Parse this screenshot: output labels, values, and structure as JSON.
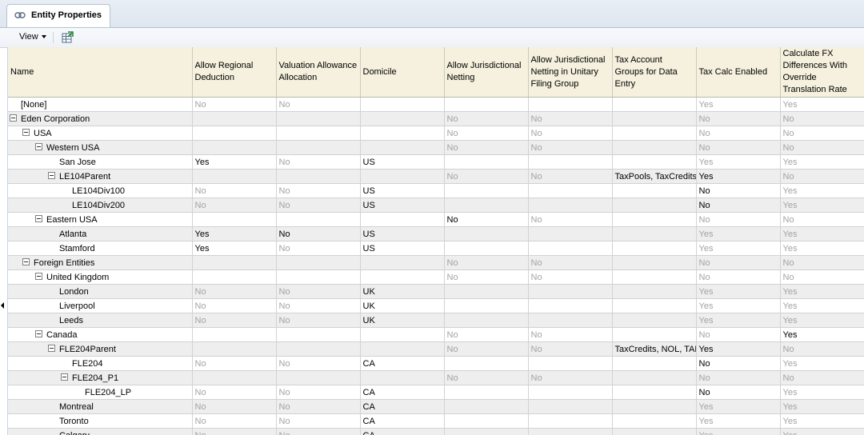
{
  "tab": {
    "title": "Entity Properties",
    "icon": "link-icon"
  },
  "toolbar": {
    "view_label": "View",
    "export_icon": "export-grid-icon"
  },
  "columns": [
    "Name",
    "Allow Regional Deduction",
    "Valuation Allowance Allocation",
    "Domicile",
    "Allow Jurisdictional Netting",
    "Allow Jurisdictional Netting in Unitary Filing Group",
    "Tax Account Groups for Data Entry",
    "Tax Calc Enabled",
    "Calculate FX Differences With Override Translation Rate"
  ],
  "rows": [
    {
      "name": "[None]",
      "level": 0,
      "toggle": false,
      "cells": [
        [
          "No",
          true
        ],
        [
          "No",
          true
        ],
        [
          "",
          false
        ],
        [
          "",
          false
        ],
        [
          "",
          false
        ],
        [
          "",
          false
        ],
        [
          "Yes",
          true
        ],
        [
          "Yes",
          true
        ]
      ]
    },
    {
      "name": "Eden Corporation",
      "level": 0,
      "toggle": true,
      "cells": [
        [
          "",
          false
        ],
        [
          "",
          false
        ],
        [
          "",
          false
        ],
        [
          "No",
          true
        ],
        [
          "No",
          true
        ],
        [
          "",
          false
        ],
        [
          "No",
          true
        ],
        [
          "No",
          true
        ]
      ]
    },
    {
      "name": "USA",
      "level": 1,
      "toggle": true,
      "cells": [
        [
          "",
          false
        ],
        [
          "",
          false
        ],
        [
          "",
          false
        ],
        [
          "No",
          true
        ],
        [
          "No",
          true
        ],
        [
          "",
          false
        ],
        [
          "No",
          true
        ],
        [
          "No",
          true
        ]
      ]
    },
    {
      "name": "Western USA",
      "level": 2,
      "toggle": true,
      "cells": [
        [
          "",
          false
        ],
        [
          "",
          false
        ],
        [
          "",
          false
        ],
        [
          "No",
          true
        ],
        [
          "No",
          true
        ],
        [
          "",
          false
        ],
        [
          "No",
          true
        ],
        [
          "No",
          true
        ]
      ]
    },
    {
      "name": "San Jose",
      "level": 3,
      "toggle": false,
      "cells": [
        [
          "Yes",
          false
        ],
        [
          "No",
          true
        ],
        [
          "US",
          false
        ],
        [
          "",
          false
        ],
        [
          "",
          false
        ],
        [
          "",
          false
        ],
        [
          "Yes",
          true
        ],
        [
          "Yes",
          true
        ]
      ]
    },
    {
      "name": "LE104Parent",
      "level": 3,
      "toggle": true,
      "cells": [
        [
          "",
          false
        ],
        [
          "",
          false
        ],
        [
          "",
          false
        ],
        [
          "No",
          true
        ],
        [
          "No",
          true
        ],
        [
          "TaxPools, TaxCredits",
          false
        ],
        [
          "Yes",
          false
        ],
        [
          "No",
          true
        ]
      ]
    },
    {
      "name": "LE104Div100",
      "level": 4,
      "toggle": false,
      "cells": [
        [
          "No",
          true
        ],
        [
          "No",
          true
        ],
        [
          "US",
          false
        ],
        [
          "",
          false
        ],
        [
          "",
          false
        ],
        [
          "",
          false
        ],
        [
          "No",
          false
        ],
        [
          "Yes",
          true
        ]
      ]
    },
    {
      "name": "LE104Div200",
      "level": 4,
      "toggle": false,
      "cells": [
        [
          "No",
          true
        ],
        [
          "No",
          true
        ],
        [
          "US",
          false
        ],
        [
          "",
          false
        ],
        [
          "",
          false
        ],
        [
          "",
          false
        ],
        [
          "No",
          false
        ],
        [
          "Yes",
          true
        ]
      ]
    },
    {
      "name": "Eastern USA",
      "level": 2,
      "toggle": true,
      "cells": [
        [
          "",
          false
        ],
        [
          "",
          false
        ],
        [
          "",
          false
        ],
        [
          "No",
          false
        ],
        [
          "No",
          true
        ],
        [
          "",
          false
        ],
        [
          "No",
          true
        ],
        [
          "No",
          true
        ]
      ]
    },
    {
      "name": "Atlanta",
      "level": 3,
      "toggle": false,
      "cells": [
        [
          "Yes",
          false
        ],
        [
          "No",
          false
        ],
        [
          "US",
          false
        ],
        [
          "",
          false
        ],
        [
          "",
          false
        ],
        [
          "",
          false
        ],
        [
          "Yes",
          true
        ],
        [
          "Yes",
          true
        ]
      ]
    },
    {
      "name": "Stamford",
      "level": 3,
      "toggle": false,
      "cells": [
        [
          "Yes",
          false
        ],
        [
          "No",
          true
        ],
        [
          "US",
          false
        ],
        [
          "",
          false
        ],
        [
          "",
          false
        ],
        [
          "",
          false
        ],
        [
          "Yes",
          true
        ],
        [
          "Yes",
          true
        ]
      ]
    },
    {
      "name": "Foreign Entities",
      "level": 1,
      "toggle": true,
      "cells": [
        [
          "",
          false
        ],
        [
          "",
          false
        ],
        [
          "",
          false
        ],
        [
          "No",
          true
        ],
        [
          "No",
          true
        ],
        [
          "",
          false
        ],
        [
          "No",
          true
        ],
        [
          "No",
          true
        ]
      ]
    },
    {
      "name": "United Kingdom",
      "level": 2,
      "toggle": true,
      "cells": [
        [
          "",
          false
        ],
        [
          "",
          false
        ],
        [
          "",
          false
        ],
        [
          "No",
          true
        ],
        [
          "No",
          true
        ],
        [
          "",
          false
        ],
        [
          "No",
          true
        ],
        [
          "No",
          true
        ]
      ]
    },
    {
      "name": "London",
      "level": 3,
      "toggle": false,
      "cells": [
        [
          "No",
          true
        ],
        [
          "No",
          true
        ],
        [
          "UK",
          false
        ],
        [
          "",
          false
        ],
        [
          "",
          false
        ],
        [
          "",
          false
        ],
        [
          "Yes",
          true
        ],
        [
          "Yes",
          true
        ]
      ]
    },
    {
      "name": "Liverpool",
      "level": 3,
      "toggle": false,
      "cells": [
        [
          "No",
          true
        ],
        [
          "No",
          true
        ],
        [
          "UK",
          false
        ],
        [
          "",
          false
        ],
        [
          "",
          false
        ],
        [
          "",
          false
        ],
        [
          "Yes",
          true
        ],
        [
          "Yes",
          true
        ]
      ]
    },
    {
      "name": "Leeds",
      "level": 3,
      "toggle": false,
      "cells": [
        [
          "No",
          true
        ],
        [
          "No",
          true
        ],
        [
          "UK",
          false
        ],
        [
          "",
          false
        ],
        [
          "",
          false
        ],
        [
          "",
          false
        ],
        [
          "Yes",
          true
        ],
        [
          "Yes",
          true
        ]
      ]
    },
    {
      "name": "Canada",
      "level": 2,
      "toggle": true,
      "cells": [
        [
          "",
          false
        ],
        [
          "",
          false
        ],
        [
          "",
          false
        ],
        [
          "No",
          true
        ],
        [
          "No",
          true
        ],
        [
          "",
          false
        ],
        [
          "No",
          true
        ],
        [
          "Yes",
          false
        ]
      ]
    },
    {
      "name": "FLE204Parent",
      "level": 3,
      "toggle": true,
      "cells": [
        [
          "",
          false
        ],
        [
          "",
          false
        ],
        [
          "",
          false
        ],
        [
          "No",
          true
        ],
        [
          "No",
          true
        ],
        [
          "TaxCredits, NOL, TAR",
          false
        ],
        [
          "Yes",
          false
        ],
        [
          "No",
          true
        ]
      ]
    },
    {
      "name": "FLE204",
      "level": 4,
      "toggle": false,
      "cells": [
        [
          "No",
          true
        ],
        [
          "No",
          true
        ],
        [
          "CA",
          false
        ],
        [
          "",
          false
        ],
        [
          "",
          false
        ],
        [
          "",
          false
        ],
        [
          "No",
          false
        ],
        [
          "Yes",
          true
        ]
      ]
    },
    {
      "name": "FLE204_P1",
      "level": 4,
      "toggle": true,
      "cells": [
        [
          "",
          false
        ],
        [
          "",
          false
        ],
        [
          "",
          false
        ],
        [
          "No",
          true
        ],
        [
          "No",
          true
        ],
        [
          "",
          false
        ],
        [
          "No",
          true
        ],
        [
          "No",
          true
        ]
      ]
    },
    {
      "name": "FLE204_LP",
      "level": 5,
      "toggle": false,
      "cells": [
        [
          "No",
          true
        ],
        [
          "No",
          true
        ],
        [
          "CA",
          false
        ],
        [
          "",
          false
        ],
        [
          "",
          false
        ],
        [
          "",
          false
        ],
        [
          "No",
          false
        ],
        [
          "Yes",
          true
        ]
      ]
    },
    {
      "name": "Montreal",
      "level": 3,
      "toggle": false,
      "cells": [
        [
          "No",
          true
        ],
        [
          "No",
          true
        ],
        [
          "CA",
          false
        ],
        [
          "",
          false
        ],
        [
          "",
          false
        ],
        [
          "",
          false
        ],
        [
          "Yes",
          true
        ],
        [
          "Yes",
          true
        ]
      ]
    },
    {
      "name": "Toronto",
      "level": 3,
      "toggle": false,
      "cells": [
        [
          "No",
          true
        ],
        [
          "No",
          true
        ],
        [
          "CA",
          false
        ],
        [
          "",
          false
        ],
        [
          "",
          false
        ],
        [
          "",
          false
        ],
        [
          "Yes",
          true
        ],
        [
          "Yes",
          true
        ]
      ]
    },
    {
      "name": "Calgary",
      "level": 3,
      "toggle": false,
      "cells": [
        [
          "No",
          true
        ],
        [
          "No",
          true
        ],
        [
          "CA",
          false
        ],
        [
          "",
          false
        ],
        [
          "",
          false
        ],
        [
          "",
          false
        ],
        [
          "Yes",
          true
        ],
        [
          "Yes",
          true
        ]
      ]
    }
  ]
}
